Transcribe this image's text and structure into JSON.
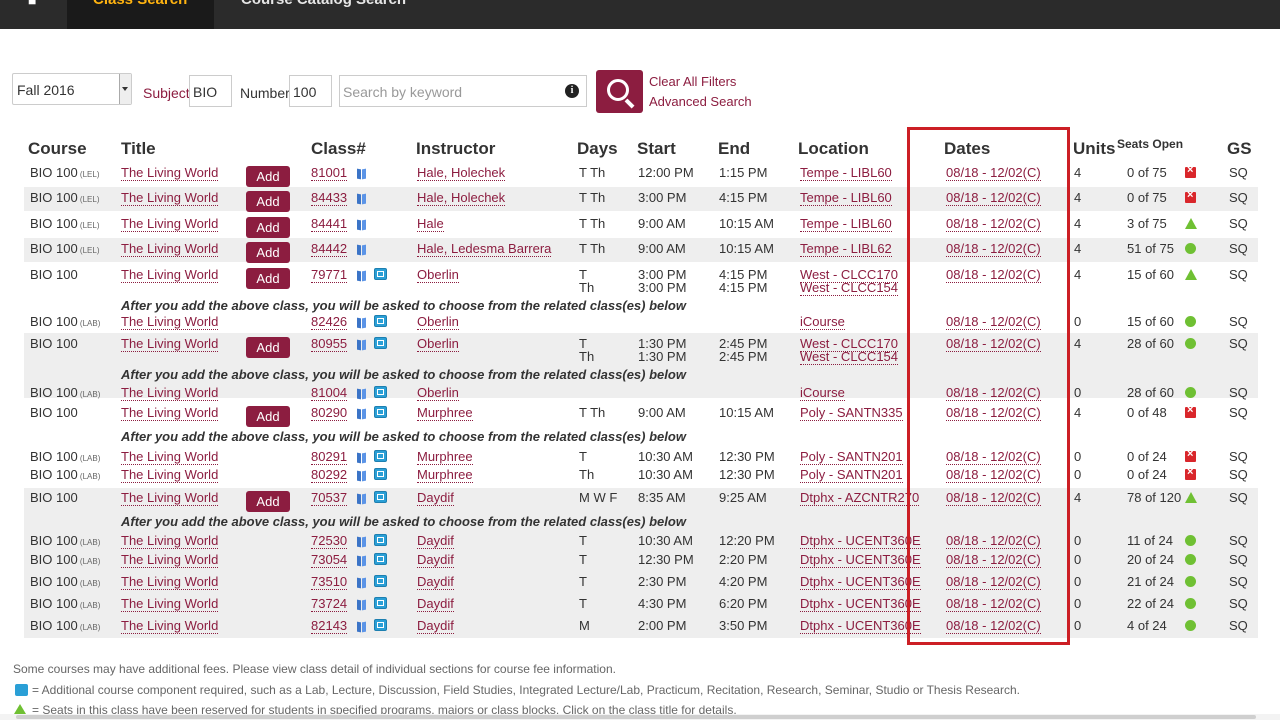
{
  "nav": {
    "home_icon": "home-icon",
    "tabs": [
      {
        "label": "Class Search",
        "active": true
      },
      {
        "label": "Course Catalog Search",
        "active": false
      }
    ],
    "accent": "#ffb310"
  },
  "filters": {
    "term": "Fall 2016",
    "subject_label": "Subject",
    "subject_value": "BIO",
    "number_label": "Number",
    "number_value": "100",
    "keyword_placeholder": "Search by keyword",
    "clear_label": "Clear All Filters",
    "advanced_label": "Advanced Search"
  },
  "columns": {
    "course": "Course",
    "title": "Title",
    "class": "Class#",
    "instructor": "Instructor",
    "days": "Days",
    "start": "Start",
    "end": "End",
    "location": "Location",
    "dates": "Dates",
    "units": "Units",
    "seats": "Seats Open",
    "gs": "GS"
  },
  "add_label": "Add",
  "related_note": "After you add the above class, you will be asked to choose from the related class(es) below",
  "rows": [
    {
      "course": "BIO 100",
      "tag": "(LEL)",
      "title": "The Living World",
      "add": true,
      "classno": "81001",
      "comp": false,
      "instructor": "Hale, Holechek",
      "days": "T Th",
      "days2": "",
      "start": "12:00 PM",
      "start2": "",
      "end": "1:15 PM",
      "end2": "",
      "location": "Tempe - LIBL60",
      "location2": "",
      "dates": "08/18 - 12/02(C)",
      "units": "4",
      "seats": "0 of 75",
      "status": "full",
      "gs": "SQ"
    },
    {
      "course": "BIO 100",
      "tag": "(LEL)",
      "title": "The Living World",
      "add": true,
      "classno": "84433",
      "comp": false,
      "instructor": "Hale, Holechek",
      "days": "T Th",
      "days2": "",
      "start": "3:00 PM",
      "start2": "",
      "end": "4:15 PM",
      "end2": "",
      "location": "Tempe - LIBL60",
      "location2": "",
      "dates": "08/18 - 12/02(C)",
      "units": "4",
      "seats": "0 of 75",
      "status": "full",
      "gs": "SQ"
    },
    {
      "course": "BIO 100",
      "tag": "(LEL)",
      "title": "The Living World",
      "add": true,
      "classno": "84441",
      "comp": false,
      "instructor": "Hale",
      "days": "T Th",
      "days2": "",
      "start": "9:00 AM",
      "start2": "",
      "end": "10:15 AM",
      "end2": "",
      "location": "Tempe - LIBL60",
      "location2": "",
      "dates": "08/18 - 12/02(C)",
      "units": "4",
      "seats": "3 of 75",
      "status": "reserved",
      "gs": "SQ"
    },
    {
      "course": "BIO 100",
      "tag": "(LEL)",
      "title": "The Living World",
      "add": true,
      "classno": "84442",
      "comp": false,
      "instructor": "Hale, Ledesma Barrera",
      "days": "T Th",
      "days2": "",
      "start": "9:00 AM",
      "start2": "",
      "end": "10:15 AM",
      "end2": "",
      "location": "Tempe - LIBL62",
      "location2": "",
      "dates": "08/18 - 12/02(C)",
      "units": "4",
      "seats": "51 of 75",
      "status": "open",
      "gs": "SQ"
    },
    {
      "course": "BIO 100",
      "tag": "",
      "title": "The Living World",
      "add": true,
      "classno": "79771",
      "comp": true,
      "instructor": "Oberlin",
      "days": "T",
      "days2": "Th",
      "start": "3:00 PM",
      "start2": "3:00 PM",
      "end": "4:15 PM",
      "end2": "4:15 PM",
      "location": "West - CLCC170",
      "location2": "West - CLCC154",
      "dates": "08/18 - 12/02(C)",
      "units": "4",
      "seats": "15 of 60",
      "status": "reserved",
      "gs": "SQ"
    },
    {
      "course": "BIO 100",
      "tag": "(LAB)",
      "title": "The Living World",
      "add": false,
      "classno": "82426",
      "comp": true,
      "instructor": "Oberlin",
      "days": "",
      "days2": "",
      "start": "",
      "start2": "",
      "end": "",
      "end2": "",
      "location": "iCourse",
      "location2": "",
      "dates": "08/18 - 12/02(C)",
      "units": "0",
      "seats": "15 of 60",
      "status": "open",
      "gs": "SQ"
    },
    {
      "course": "BIO 100",
      "tag": "",
      "title": "The Living World",
      "add": true,
      "classno": "80955",
      "comp": true,
      "instructor": "Oberlin",
      "days": "T",
      "days2": "Th",
      "start": "1:30 PM",
      "start2": "1:30 PM",
      "end": "2:45 PM",
      "end2": "2:45 PM",
      "location": "West - CLCC170",
      "location2": "West - CLCC154",
      "dates": "08/18 - 12/02(C)",
      "units": "4",
      "seats": "28 of 60",
      "status": "open",
      "gs": "SQ"
    },
    {
      "course": "BIO 100",
      "tag": "(LAB)",
      "title": "The Living World",
      "add": false,
      "classno": "81004",
      "comp": true,
      "instructor": "Oberlin",
      "days": "",
      "days2": "",
      "start": "",
      "start2": "",
      "end": "",
      "end2": "",
      "location": "iCourse",
      "location2": "",
      "dates": "08/18 - 12/02(C)",
      "units": "0",
      "seats": "28 of 60",
      "status": "open",
      "gs": "SQ"
    },
    {
      "course": "BIO 100",
      "tag": "",
      "title": "The Living World",
      "add": true,
      "classno": "80290",
      "comp": true,
      "instructor": "Murphree",
      "days": "T Th",
      "days2": "",
      "start": "9:00 AM",
      "start2": "",
      "end": "10:15 AM",
      "end2": "",
      "location": "Poly - SANTN335",
      "location2": "",
      "dates": "08/18 - 12/02(C)",
      "units": "4",
      "seats": "0 of 48",
      "status": "full",
      "gs": "SQ"
    },
    {
      "course": "BIO 100",
      "tag": "(LAB)",
      "title": "The Living World",
      "add": false,
      "classno": "80291",
      "comp": true,
      "instructor": "Murphree",
      "days": "T",
      "days2": "",
      "start": "10:30 AM",
      "start2": "",
      "end": "12:30 PM",
      "end2": "",
      "location": "Poly - SANTN201",
      "location2": "",
      "dates": "08/18 - 12/02(C)",
      "units": "0",
      "seats": "0 of 24",
      "status": "full",
      "gs": "SQ"
    },
    {
      "course": "BIO 100",
      "tag": "(LAB)",
      "title": "The Living World",
      "add": false,
      "classno": "80292",
      "comp": true,
      "instructor": "Murphree",
      "days": "Th",
      "days2": "",
      "start": "10:30 AM",
      "start2": "",
      "end": "12:30 PM",
      "end2": "",
      "location": "Poly - SANTN201",
      "location2": "",
      "dates": "08/18 - 12/02(C)",
      "units": "0",
      "seats": "0 of 24",
      "status": "full",
      "gs": "SQ"
    },
    {
      "course": "BIO 100",
      "tag": "",
      "title": "The Living World",
      "add": true,
      "classno": "70537",
      "comp": true,
      "instructor": "Daydif",
      "days": "M W F",
      "days2": "",
      "start": "8:35 AM",
      "start2": "",
      "end": "9:25 AM",
      "end2": "",
      "location": "Dtphx - AZCNTR270",
      "location2": "",
      "dates": "08/18 - 12/02(C)",
      "units": "4",
      "seats": "78 of 120",
      "status": "reserved",
      "gs": "SQ"
    },
    {
      "course": "BIO 100",
      "tag": "(LAB)",
      "title": "The Living World",
      "add": false,
      "classno": "72530",
      "comp": true,
      "instructor": "Daydif",
      "days": "T",
      "days2": "",
      "start": "10:30 AM",
      "start2": "",
      "end": "12:20 PM",
      "end2": "",
      "location": "Dtphx - UCENT360E",
      "location2": "",
      "dates": "08/18 - 12/02(C)",
      "units": "0",
      "seats": "11 of 24",
      "status": "open",
      "gs": "SQ"
    },
    {
      "course": "BIO 100",
      "tag": "(LAB)",
      "title": "The Living World",
      "add": false,
      "classno": "73054",
      "comp": true,
      "instructor": "Daydif",
      "days": "T",
      "days2": "",
      "start": "12:30 PM",
      "start2": "",
      "end": "2:20 PM",
      "end2": "",
      "location": "Dtphx - UCENT360E",
      "location2": "",
      "dates": "08/18 - 12/02(C)",
      "units": "0",
      "seats": "20 of 24",
      "status": "open",
      "gs": "SQ"
    },
    {
      "course": "BIO 100",
      "tag": "(LAB)",
      "title": "The Living World",
      "add": false,
      "classno": "73510",
      "comp": true,
      "instructor": "Daydif",
      "days": "T",
      "days2": "",
      "start": "2:30 PM",
      "start2": "",
      "end": "4:20 PM",
      "end2": "",
      "location": "Dtphx - UCENT360E",
      "location2": "",
      "dates": "08/18 - 12/02(C)",
      "units": "0",
      "seats": "21 of 24",
      "status": "open",
      "gs": "SQ"
    },
    {
      "course": "BIO 100",
      "tag": "(LAB)",
      "title": "The Living World",
      "add": false,
      "classno": "73724",
      "comp": true,
      "instructor": "Daydif",
      "days": "T",
      "days2": "",
      "start": "4:30 PM",
      "start2": "",
      "end": "6:20 PM",
      "end2": "",
      "location": "Dtphx - UCENT360E",
      "location2": "",
      "dates": "08/18 - 12/02(C)",
      "units": "0",
      "seats": "22 of 24",
      "status": "open",
      "gs": "SQ"
    },
    {
      "course": "BIO 100",
      "tag": "(LAB)",
      "title": "The Living World",
      "add": false,
      "classno": "82143",
      "comp": true,
      "instructor": "Daydif",
      "days": "M",
      "days2": "",
      "start": "2:00 PM",
      "start2": "",
      "end": "3:50 PM",
      "end2": "",
      "location": "Dtphx - UCENT360E",
      "location2": "",
      "dates": "08/18 - 12/02(C)",
      "units": "0",
      "seats": "4 of 24",
      "status": "open",
      "gs": "SQ"
    }
  ],
  "footer": {
    "fees": "Some courses may have additional fees. Please view class detail of individual sections for course fee information.",
    "component": "= Additional course component required, such as a Lab, Lecture, Discussion, Field Studies, Integrated Lecture/Lab, Practicum, Recitation, Research, Seminar, Studio or Thesis Research.",
    "reserved": "= Seats in this class have been reserved for students in specified programs, majors or class blocks. Click on the class title for details."
  },
  "colors": {
    "brand": "#8c1d40",
    "highlight_box": "#cc1f25",
    "open": "#6fc033",
    "full": "#d9262b"
  }
}
